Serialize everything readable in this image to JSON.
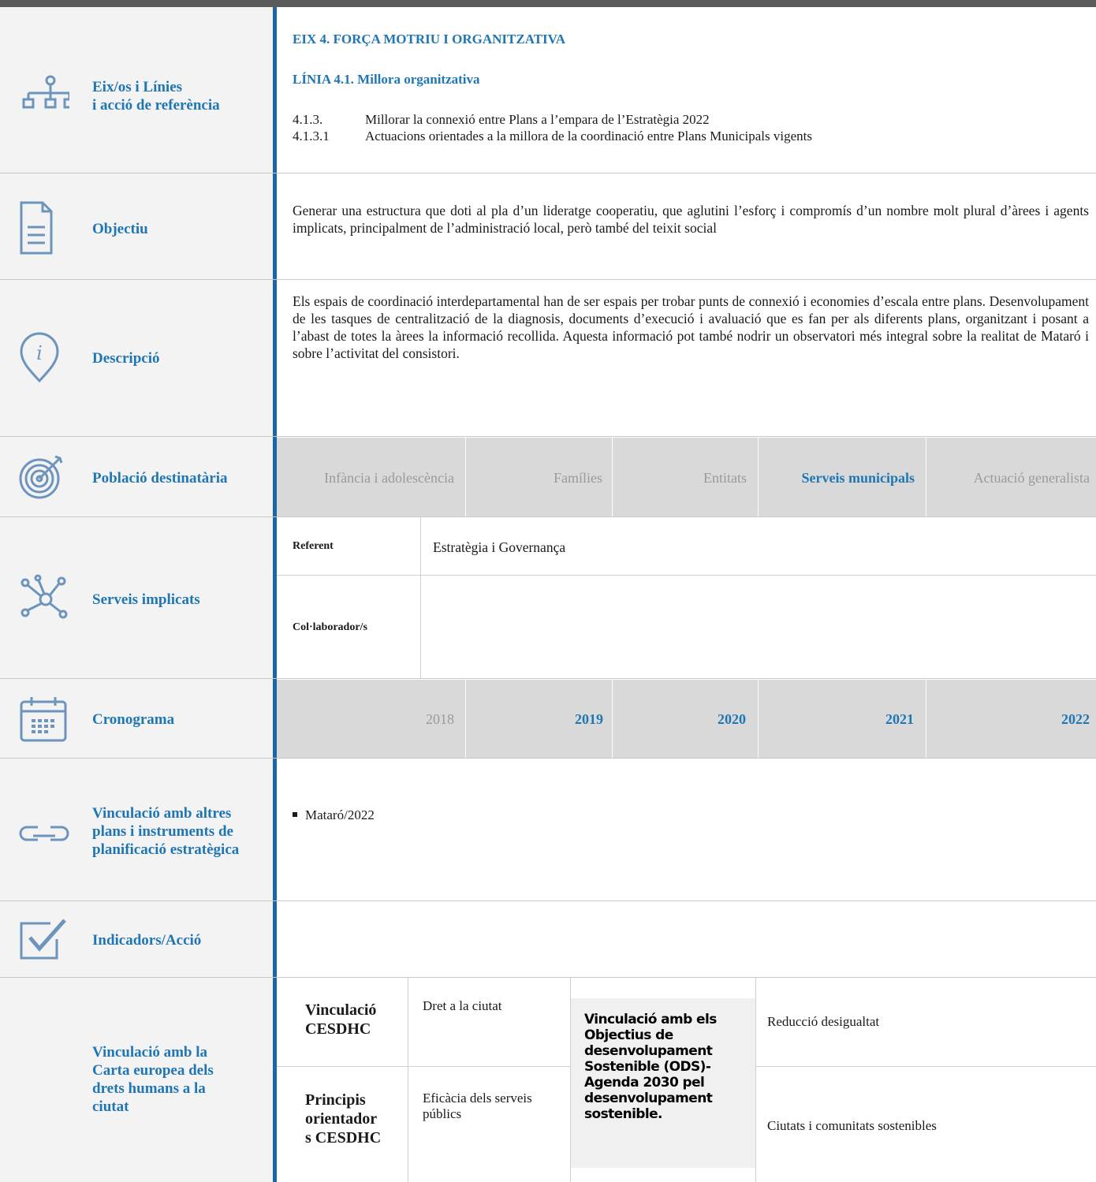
{
  "rows": {
    "eix": {
      "label_line1": "Eix/os i Línies",
      "label_line2": "i acció de referència",
      "eix_title": "EIX 4. FORÇA MOTRIU I ORGANITZATIVA",
      "linia_title": "LÍNIA 4.1.  Millora organitzativa",
      "items": [
        {
          "num": "4.1.3.",
          "text": "Millorar la connexió entre Plans a l’empara de l’Estratègia 2022"
        },
        {
          "num": "4.1.3.1",
          "text": "Actuacions orientades a la millora de la coordinació entre Plans Municipals vigents"
        }
      ]
    },
    "objectiu": {
      "label": "Objectiu",
      "text": "Generar una estructura que doti al pla d’un lideratge cooperatiu, que aglutini l’esforç i compromís d’un nombre molt plural d’àrees i agents implicats, principalment de l’administració local, però també del teixit social"
    },
    "descripcio": {
      "label": "Descripció",
      "text": "Els espais de coordinació interdepartamental han de ser espais per trobar punts de connexió i economies d’escala entre plans. Desenvolupament de les tasques de centralització de la diagnosis, documents d’execució i avaluació que es fan per als diferents plans, organitzant i posant a l’abast de totes la àrees la informació recollida. Aquesta informació pot també nodrir un observatori més integral sobre la realitat de Mataró i sobre l’activitat del consistori."
    },
    "poblacio": {
      "label": "Població destinatària",
      "options": [
        {
          "label": "Infància i adolescència",
          "active": false
        },
        {
          "label": "Famílies",
          "active": false
        },
        {
          "label": "Entitats",
          "active": false
        },
        {
          "label": "Serveis municipals",
          "active": true
        },
        {
          "label": "Actuació generalista",
          "active": false
        }
      ]
    },
    "serveis": {
      "label": "Serveis implicats",
      "referent_label": "Referent",
      "referent_value": "Estratègia i Governança",
      "collaborador_label": "Col·laborador/s",
      "collaborador_value": ""
    },
    "cronograma": {
      "label": "Cronograma",
      "years": [
        {
          "label": "2018",
          "active": false
        },
        {
          "label": "2019",
          "active": true
        },
        {
          "label": "2020",
          "active": true
        },
        {
          "label": "2021",
          "active": true
        },
        {
          "label": "2022",
          "active": true
        }
      ]
    },
    "vinculacio": {
      "label_line1": "Vinculació amb altres",
      "label_line2": "plans i instruments de",
      "label_line3": "planificació estratègica",
      "items": [
        "Mataró/2022"
      ]
    },
    "indicadors": {
      "label": "Indicadors/Acció"
    },
    "carta": {
      "label_line1": "Vinculació amb la",
      "label_line2": "Carta europea dels",
      "label_line3": "drets humans a la",
      "label_line4": "ciutat",
      "cesdhc_label_line1": "Vinculació",
      "cesdhc_label_line2": "CESDHC",
      "cesdhc_value": "Dret a la ciutat",
      "principis_label_line1": "Principis",
      "principis_label_line2": "orientador",
      "principis_label_line3": "s CESDHC",
      "principis_value_line1": "Eficàcia dels serveis",
      "principis_value_line2": "públics",
      "ods_label": "Vinculació amb els Objectius de desenvolupament Sostenible (ODS)- Agenda 2030 pel desenvolupament sostenible.",
      "ods_value1": "Reducció desigualtat",
      "ods_value2": "Ciutats i comunitats sostenibles"
    }
  },
  "icons": [
    "org-chart-icon",
    "document-icon",
    "info-icon",
    "target-icon",
    "network-icon",
    "calendar-icon",
    "link-icon",
    "checkbox-icon"
  ],
  "colors": {
    "accent": "#2076b3",
    "rule": "#1d66a6",
    "band": "#d9d9d9",
    "muted": "#9a9a9a"
  }
}
